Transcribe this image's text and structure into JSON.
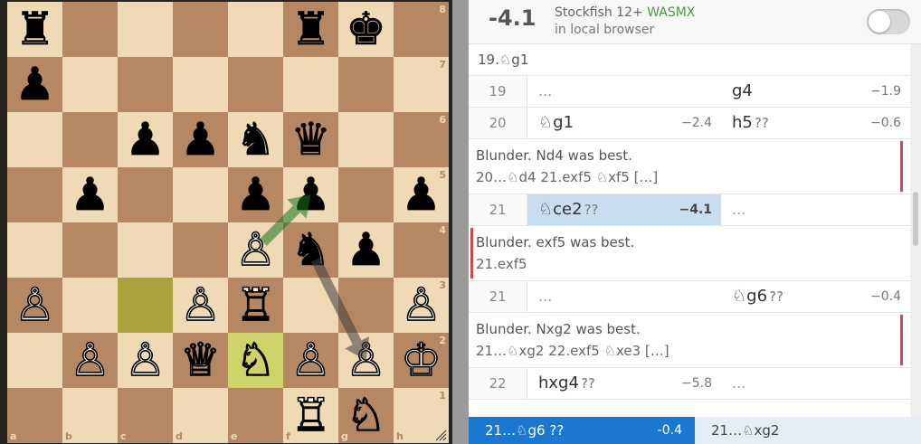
{
  "board": {
    "ranks": [
      "8",
      "7",
      "6",
      "5",
      "4",
      "3",
      "2",
      "1"
    ],
    "files": [
      "a",
      "b",
      "c",
      "d",
      "e",
      "f",
      "g",
      "h"
    ],
    "pieces": {
      "a8": "♜",
      "f8": "♜",
      "g8": "♚",
      "a7": "♟",
      "c6": "♟",
      "d6": "♟",
      "e6": "♞",
      "f6": "♛",
      "b5": "♟",
      "e5": "♟",
      "f5": "♟",
      "h5": "♟",
      "e4": "♙",
      "f4": "♞",
      "g4": "♟",
      "a3": "♙",
      "d3": "♙",
      "e3": "♖",
      "h3": "♙",
      "b2": "♙",
      "c2": "♙",
      "d2": "♕",
      "e2": "♘",
      "f2": "♙",
      "g2": "♙",
      "h2": "♔",
      "f1": "♖",
      "g1": "♘"
    },
    "white_pieces": [
      "e4",
      "a3",
      "d3",
      "e3",
      "h3",
      "b2",
      "c2",
      "d2",
      "e2",
      "f2",
      "g2",
      "h2",
      "f1",
      "g1"
    ],
    "highlights": {
      "c3": "last-move-from",
      "e2": "last-move-to"
    },
    "arrows": [
      {
        "from": "e4",
        "to": "f5",
        "color": "#15781b"
      },
      {
        "from": "f4",
        "to": "g2",
        "color": "#3c3c3c"
      }
    ]
  },
  "ceval": {
    "score": "-4.1",
    "engine": "Stockfish 12+",
    "flag": "WASMX",
    "location": "in local browser",
    "enabled": false
  },
  "moves": {
    "prev_line": "19.♘g1",
    "rows": [
      {
        "num": "19",
        "white": {
          "san": "...",
          "glyph": "",
          "eval": ""
        },
        "black": {
          "san": "g4",
          "glyph": "",
          "eval": "−1.9"
        }
      },
      {
        "num": "20",
        "white": {
          "san": "♘g1",
          "glyph": "",
          "eval": "−2.4"
        },
        "black": {
          "san": "h5",
          "glyph": "??",
          "eval": "−0.6"
        }
      }
    ],
    "comment1": {
      "text": "Blunder. Nd4 was best.",
      "var": "20…♘d4 21.exf5 ♘xf5 […]"
    },
    "row21": {
      "num": "21",
      "white": {
        "san": "♘ce2",
        "glyph": "??",
        "eval": "−4.1"
      },
      "black": {
        "san": "...",
        "glyph": "",
        "eval": ""
      }
    },
    "comment2": {
      "text": "Blunder. exf5 was best.",
      "var": "21.exf5"
    },
    "row21b": {
      "num": "21",
      "white": {
        "san": "...",
        "glyph": "",
        "eval": ""
      },
      "black": {
        "san": "♘g6",
        "glyph": "??",
        "eval": "−0.4"
      }
    },
    "comment3": {
      "text": "Blunder. Nxg2 was best.",
      "var": "21…♘xg2 22.exf5 ♘xe3 […]"
    },
    "row22": {
      "num": "22",
      "white": {
        "san": "hxg4",
        "glyph": "??",
        "eval": "−5.8"
      },
      "black": {
        "san": "...",
        "glyph": "",
        "eval": ""
      }
    }
  },
  "bottom": {
    "current_move": "21…♘g6 ??",
    "current_eval": "-0.4",
    "best_move": "21…♘xg2"
  },
  "colors": {
    "accent": "#1b78d0",
    "blunder": "#c34d4d",
    "light_square": "#f0d9b5",
    "dark_square": "#b58863"
  }
}
